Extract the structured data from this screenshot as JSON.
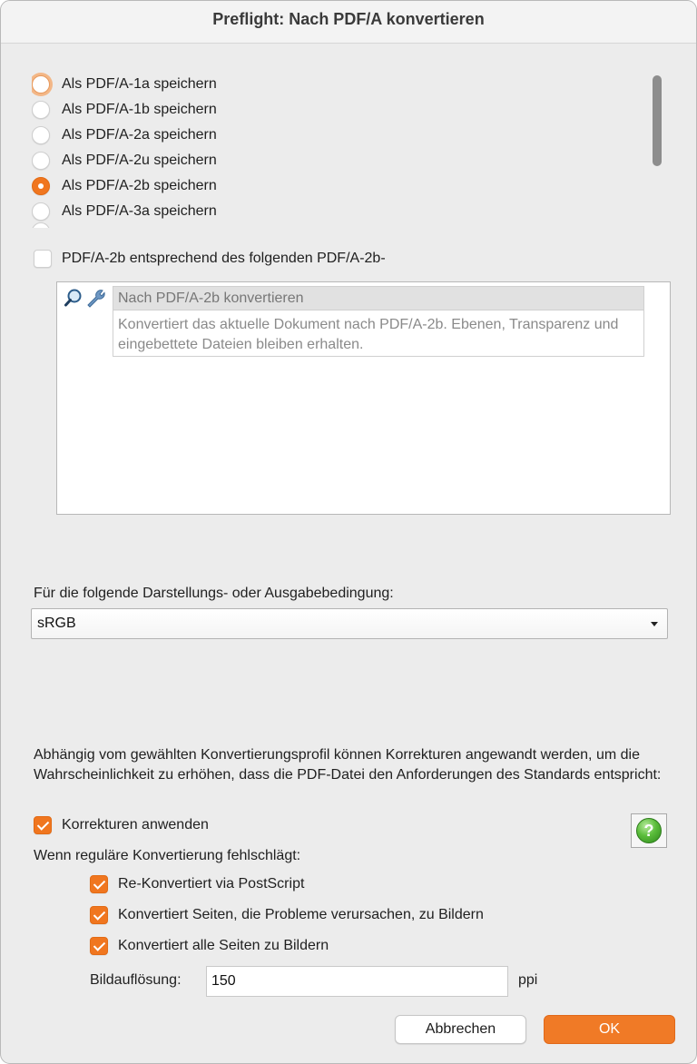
{
  "window": {
    "title": "Preflight: Nach PDF/A konvertieren"
  },
  "conformance": {
    "options": [
      {
        "label": "Als PDF/A-1a speichern",
        "selected": false,
        "focused": true
      },
      {
        "label": "Als PDF/A-1b speichern",
        "selected": false
      },
      {
        "label": "Als PDF/A-2a speichern",
        "selected": false
      },
      {
        "label": "Als PDF/A-2u speichern",
        "selected": false
      },
      {
        "label": "Als PDF/A-2b speichern",
        "selected": true
      },
      {
        "label": "Als PDF/A-3a speichern",
        "selected": false
      }
    ]
  },
  "profile_check": {
    "label": "PDF/A-2b entsprechend des folgenden PDF/A-2b-",
    "checked": false
  },
  "profile": {
    "name": "Nach PDF/A-2b konvertieren",
    "description": "Konvertiert das aktuelle Dokument nach PDF/A-2b. Ebenen, Transparenz und eingebettete Dateien bleiben erhalten.",
    "icons": [
      "magnifier-icon",
      "wrench-icon"
    ]
  },
  "output_condition": {
    "label": "Für die folgende Darstellungs- oder Ausgabebedingung:",
    "value": "sRGB"
  },
  "corrections": {
    "text": "Abhängig vom gewählten Konvertierungsprofil können Korrekturen angewandt werden, um die Wahrscheinlichkeit zu erhöhen, dass die PDF-Datei den Anforderungen des Standards entspricht:",
    "apply_label": "Korrekturen anwenden",
    "apply_checked": true,
    "help_symbol": "?"
  },
  "fallback": {
    "heading": "Wenn reguläre Konvertierung fehlschlägt:",
    "options": [
      {
        "label": "Re-Konvertiert via PostScript",
        "checked": true
      },
      {
        "label": "Konvertiert Seiten, die Probleme verursachen, zu Bildern",
        "checked": true
      },
      {
        "label": "Konvertiert alle Seiten zu Bildern",
        "checked": true
      }
    ],
    "resolution_label": "Bildauflösung:",
    "resolution_value": "150",
    "resolution_unit": "ppi"
  },
  "buttons": {
    "cancel": "Abbrechen",
    "ok": "OK"
  },
  "colors": {
    "accent": "#f0761f",
    "help_green": "#5bbd3b"
  }
}
